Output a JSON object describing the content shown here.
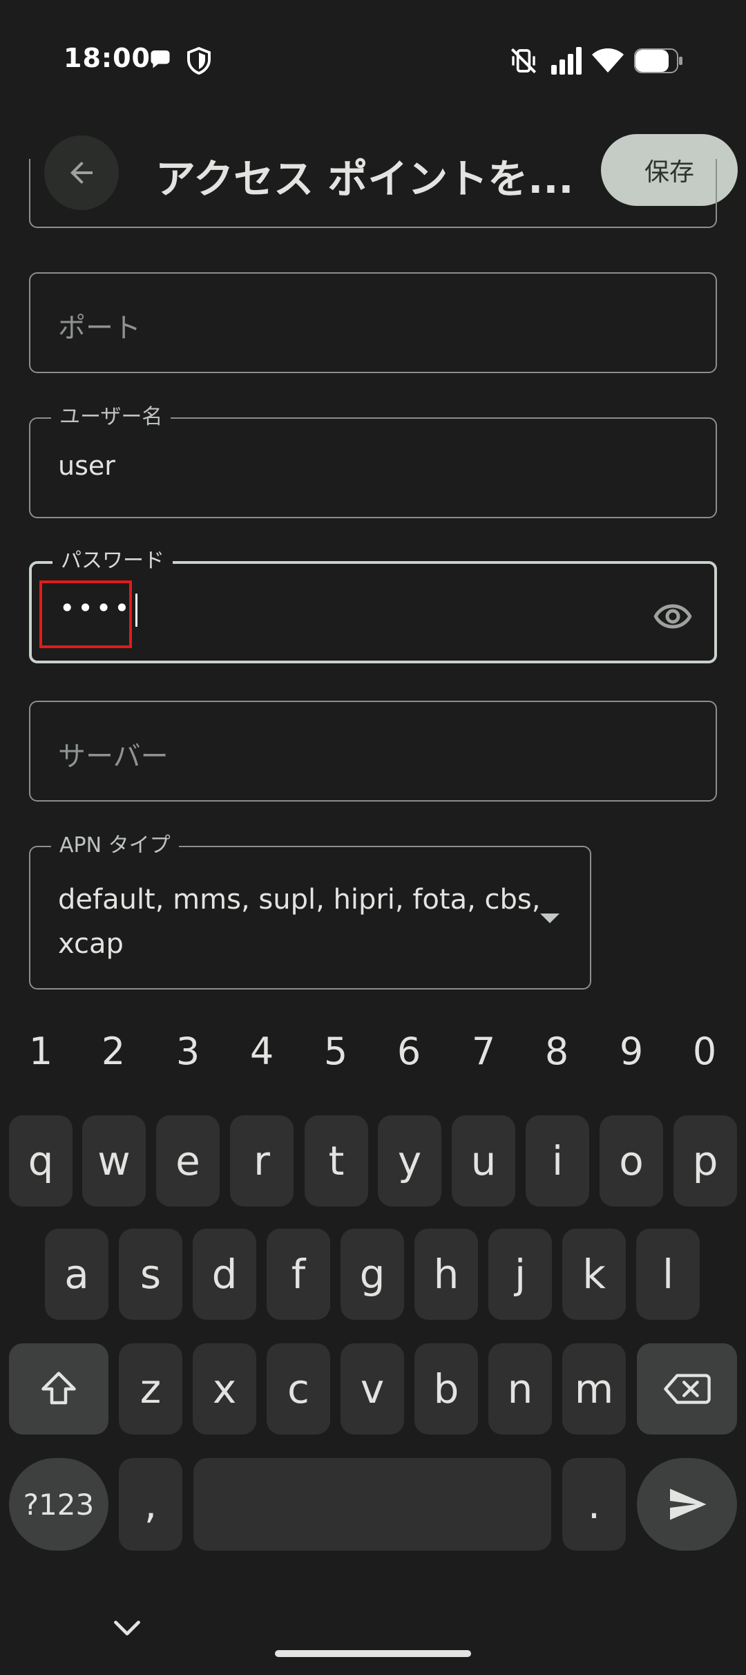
{
  "status_bar": {
    "time": "18:00"
  },
  "app_bar": {
    "title": "アクセス ポイントを...",
    "save_label": "保存"
  },
  "fields": {
    "port": {
      "placeholder": "ポート"
    },
    "username": {
      "label": "ユーザー名",
      "value": "user"
    },
    "password": {
      "label": "パスワード",
      "value": "••••"
    },
    "server": {
      "placeholder": "サーバー"
    },
    "apn_type": {
      "label": "APN タイプ",
      "value": "default, mms, supl, hipri, fota, cbs, xcap"
    }
  },
  "keyboard": {
    "numbers": [
      "1",
      "2",
      "3",
      "4",
      "5",
      "6",
      "7",
      "8",
      "9",
      "0"
    ],
    "row1": [
      "q",
      "w",
      "e",
      "r",
      "t",
      "y",
      "u",
      "i",
      "o",
      "p"
    ],
    "row2": [
      "a",
      "s",
      "d",
      "f",
      "g",
      "h",
      "j",
      "k",
      "l"
    ],
    "row3": [
      "z",
      "x",
      "c",
      "v",
      "b",
      "n",
      "m"
    ],
    "symbols_label": "?123",
    "comma": ",",
    "period": "."
  },
  "colors": {
    "background": "#1b1c1b",
    "key": "#2f302f",
    "function_key": "#3d403f",
    "focus_border": "#c9d2cb",
    "highlight": "#e31b1b",
    "save_button": "#c4ccc5"
  },
  "icons": {
    "back": "arrow-left-icon",
    "eye": "eye-icon",
    "dropdown": "dropdown-arrow-icon",
    "shift": "shift-icon",
    "backspace": "backspace-icon",
    "send": "send-icon",
    "hide_keyboard": "chevron-down-icon"
  }
}
